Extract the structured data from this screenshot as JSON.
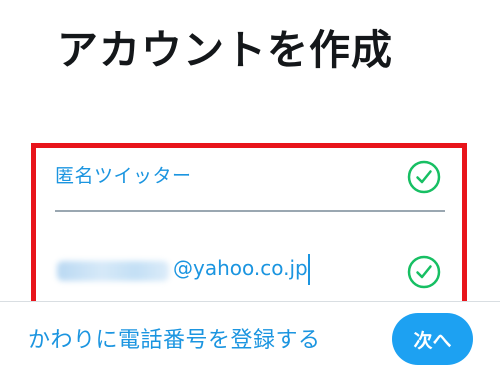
{
  "page": {
    "title": "アカウントを作成"
  },
  "form": {
    "name_value": "匿名ツイッター",
    "email_domain": "@yahoo.co.jp"
  },
  "icons": {
    "valid_check": "check-circle-icon"
  },
  "colors": {
    "accent": "#1da1f2",
    "link": "#1b95e0",
    "success": "#17bf63",
    "highlight": "#e8141b"
  },
  "footer": {
    "alt_link_label": "かわりに電話番号を登録する",
    "next_button_label": "次へ"
  }
}
